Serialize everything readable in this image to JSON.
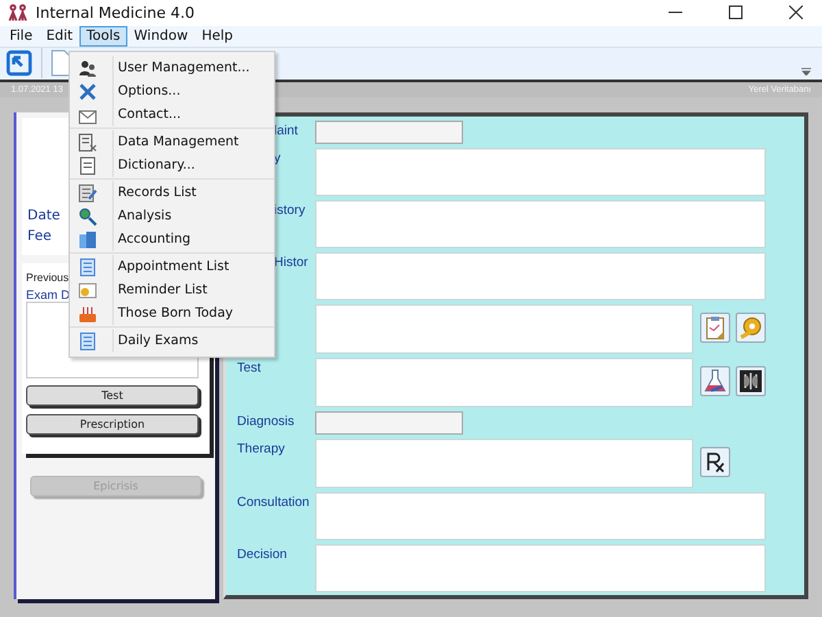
{
  "window": {
    "title": "Internal Medicine 4.0"
  },
  "menu_bar": [
    {
      "label": "File",
      "selected": false
    },
    {
      "label": "Edit",
      "selected": false
    },
    {
      "label": "Tools",
      "selected": true
    },
    {
      "label": "Window",
      "selected": false
    },
    {
      "label": "Help",
      "selected": false
    }
  ],
  "tools_menu": {
    "groups": [
      {
        "items": [
          {
            "label": "User Management...",
            "kind": "users"
          },
          {
            "label": "Options...",
            "kind": "tools"
          },
          {
            "label": "Contact...",
            "kind": "contact"
          }
        ]
      },
      {
        "items": [
          {
            "label": "Data Management",
            "kind": "data"
          },
          {
            "label": "Dictionary...",
            "kind": "dictionary"
          }
        ]
      },
      {
        "items": [
          {
            "label": "Records List",
            "kind": "records"
          },
          {
            "label": "Analysis",
            "kind": "analysis"
          },
          {
            "label": "Accounting",
            "kind": "accounting"
          }
        ]
      },
      {
        "items": [
          {
            "label": "Appointment List",
            "kind": "list"
          },
          {
            "label": "Reminder List",
            "kind": "reminder"
          },
          {
            "label": "Those Born Today",
            "kind": "cake"
          }
        ]
      },
      {
        "items": [
          {
            "label": "Daily Exams",
            "kind": "list"
          }
        ]
      }
    ]
  },
  "status_strip": {
    "date": "1.07.2021 13",
    "database": "Yerel Veritabanı"
  },
  "left_panel": {
    "labels": [
      "Date",
      "Fee"
    ],
    "previous_label": "Previous",
    "exam_label": "Exam D",
    "card_buttons": [
      {
        "label": "Test",
        "disabled": false
      },
      {
        "label": "Prescription",
        "disabled": false
      }
    ],
    "epicrisis_button": {
      "label": "Epicrisis",
      "disabled": true
    }
  },
  "right_panel": {
    "rows": [
      {
        "label": "laint",
        "covered": true,
        "kind": "short",
        "tools": []
      },
      {
        "label": "y",
        "covered": true,
        "kind": "wide",
        "tools": []
      },
      {
        "label": "istory",
        "covered": true,
        "kind": "wide",
        "tools": []
      },
      {
        "label": "Histor",
        "covered": true,
        "kind": "wide",
        "tools": []
      },
      {
        "label": "",
        "kind": "medium",
        "tools": [
          {
            "kind": "clipboard"
          },
          {
            "kind": "tape"
          }
        ]
      },
      {
        "label": "Test",
        "covered": false,
        "kind": "medium",
        "tools": [
          {
            "kind": "flask"
          },
          {
            "kind": "xray"
          }
        ]
      },
      {
        "label": "Diagnosis",
        "covered": false,
        "kind": "short",
        "tools": []
      },
      {
        "label": "Therapy",
        "covered": false,
        "kind": "medium",
        "tools": [
          {
            "kind": "rx"
          }
        ]
      },
      {
        "label": "Consultation",
        "covered": false,
        "kind": "wide",
        "tools": []
      },
      {
        "label": "Decision",
        "covered": false,
        "kind": "wide",
        "tools": []
      }
    ]
  }
}
